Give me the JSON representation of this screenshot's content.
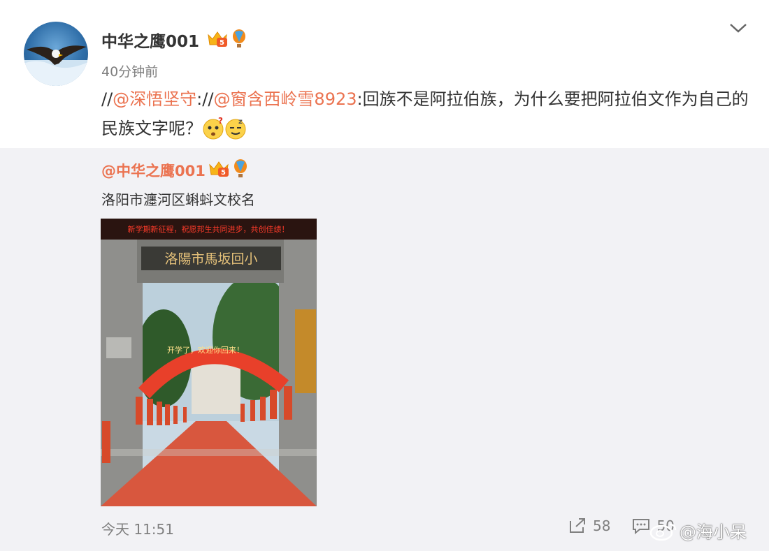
{
  "post": {
    "username": "中华之鹰001",
    "timestamp": "40分钟前",
    "text": {
      "prefix1": "//",
      "mention1": "@深悟坚守",
      "sep": ":",
      "prefix2": "//",
      "mention2": "@窗含西岭雪8923",
      "body": ":回族不是阿拉伯族，为什么要把阿拉伯文作为自己的民族文字呢？"
    },
    "badge_level": "5"
  },
  "repost": {
    "username": "@中华之鹰001",
    "text": "洛阳市瀍河区蝌蚪文校名",
    "photo": {
      "led_banner": "新学期新征程，祝愿邦生共同进步，共创佳绩！",
      "gate_sign": "洛陽市馬坂回小",
      "arch_text": "开学了，欢迎你回来！"
    },
    "time": "今天 11:51",
    "share_count": "58",
    "comment_count": "50"
  },
  "watermark": "@海小呆",
  "colors": {
    "accent": "#eb7350",
    "repost_bg": "#f2f2f5",
    "muted": "#808080"
  }
}
